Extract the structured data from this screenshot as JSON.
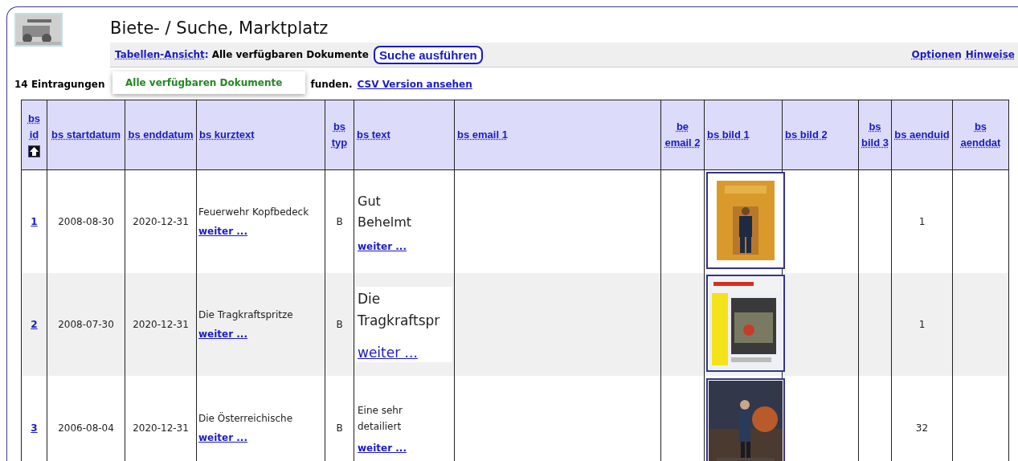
{
  "page": {
    "title": "Biete- / Suche, Marktplatz"
  },
  "toolbar": {
    "view_link": "Tabellen-Ansicht",
    "separator": ":",
    "view_value": "Alle verfügbaren Dokumente",
    "search_button": "Suche ausführen",
    "links": [
      "Optionen",
      "Hinweise"
    ]
  },
  "view_menu": {
    "items": [
      {
        "label": "Alle verfügbaren Dokumente"
      }
    ]
  },
  "status": {
    "count_text": "14 Eintragungen",
    "found_text": "funden.",
    "csv_link": "CSV Version ansehen"
  },
  "table": {
    "columns": [
      {
        "label": "bs id",
        "sorted": true
      },
      {
        "label": "bs startdatum",
        "sorted": false
      },
      {
        "label": "bs enddatum",
        "sorted": false
      },
      {
        "label": "bs kurztext",
        "sorted": false
      },
      {
        "label": "bs typ",
        "sorted": false
      },
      {
        "label": "bs text",
        "sorted": false
      },
      {
        "label": "bs email 1",
        "sorted": false
      },
      {
        "label": "be email 2",
        "sorted": false
      },
      {
        "label": "bs bild 1",
        "sorted": false
      },
      {
        "label": "bs bild 2",
        "sorted": false
      },
      {
        "label": "bs bild 3",
        "sorted": false
      },
      {
        "label": "bs aenduid",
        "sorted": false
      },
      {
        "label": "bs aenddat",
        "sorted": false
      }
    ],
    "rows": [
      {
        "id": "1",
        "startdatum": "2008-08-30",
        "enddatum": "2020-12-31",
        "kurztext": "Feuerwehr Kopfbedeck",
        "kurztext_more": "weiter ...",
        "typ": "B",
        "text": "Gut Behelmt",
        "kind": "medium",
        "text_more": "weiter ...",
        "aenduid": "1"
      },
      {
        "id": "2",
        "startdatum": "2008-07-30",
        "enddatum": "2020-12-31",
        "kurztext": "Die Tragkraftspritze",
        "kurztext_more": "weiter ...",
        "typ": "B",
        "text": "Die Tragkraftspr",
        "kind": "large",
        "text_more": "weiter ...",
        "aenduid": "1"
      },
      {
        "id": "3",
        "startdatum": "2006-08-04",
        "enddatum": "2020-12-31",
        "kurztext": "Die Österreichische",
        "kurztext_more": "weiter ...",
        "typ": "B",
        "text": "Eine sehr detailiert",
        "kind": "small",
        "text_more": "weiter ...",
        "aenduid": "32"
      }
    ]
  }
}
